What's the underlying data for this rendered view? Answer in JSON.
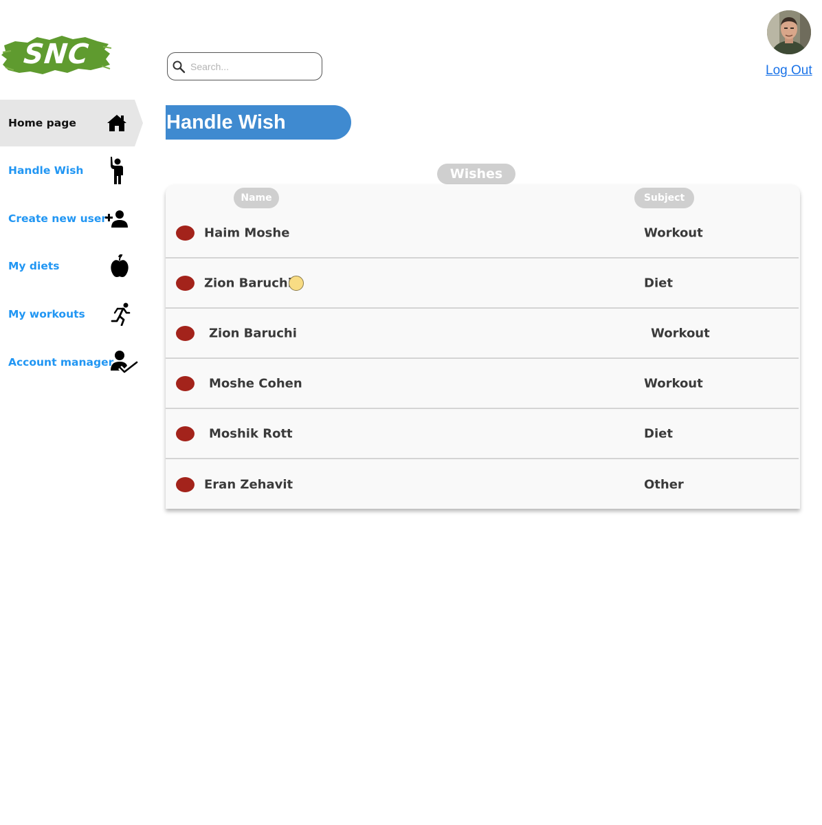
{
  "logo": {
    "text": "SNC",
    "color": "#5f9b2f"
  },
  "search": {
    "placeholder": "Search..."
  },
  "header": {
    "logout_label": "Log Out"
  },
  "sidebar": {
    "items": [
      {
        "label": "Home page",
        "icon": "home-icon",
        "active": true
      },
      {
        "label": "Handle Wish",
        "icon": "raised-hand-person-icon",
        "active": false
      },
      {
        "label": "Create new user",
        "icon": "add-user-icon",
        "active": false
      },
      {
        "label": "My diets",
        "icon": "apple-icon",
        "active": false
      },
      {
        "label": "My workouts",
        "icon": "running-person-icon",
        "active": false
      },
      {
        "label": "Account manager",
        "icon": "user-check-icon",
        "active": false
      }
    ]
  },
  "main": {
    "title": "Handle Wish",
    "section_label": "Wishes",
    "columns": {
      "name": "Name",
      "subject": "Subject"
    },
    "rows": [
      {
        "name": "Haim Moshe",
        "subject": "Workout",
        "status_color": "#a3231b",
        "has_badge": false
      },
      {
        "name": "Zion Baruchi",
        "subject": "Diet",
        "status_color": "#a3231b",
        "has_badge": true
      },
      {
        "name": "Zion Baruchi",
        "subject": "Workout",
        "status_color": "#a3231b",
        "has_badge": false
      },
      {
        "name": "Moshe Cohen",
        "subject": "Workout",
        "status_color": "#a3231b",
        "has_badge": false
      },
      {
        "name": "Moshik Rott",
        "subject": "Diet",
        "status_color": "#a3231b",
        "has_badge": false
      },
      {
        "name": "Eran Zehavit",
        "subject": "Other",
        "status_color": "#a3231b",
        "has_badge": false
      }
    ]
  },
  "colors": {
    "accent": "#3f8ad0",
    "nav_link": "#2196f3",
    "status_dot": "#a3231b",
    "badge": "#f8dc84"
  }
}
